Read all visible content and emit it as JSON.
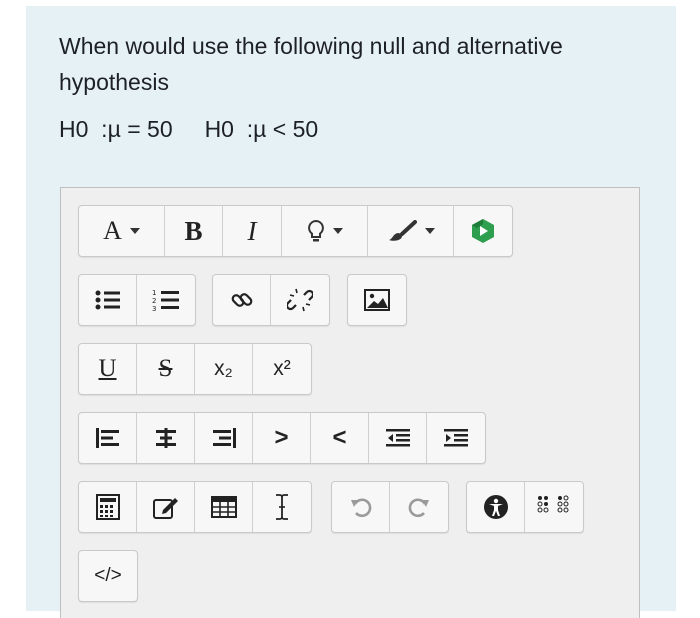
{
  "question": {
    "line1": "When would use the following null and alternative",
    "line2": "hypothesis",
    "hypotheses": "H0  :µ = 50     H0  :µ < 50"
  },
  "toolbar": {
    "font_color_label": "A",
    "bold_label": "B",
    "italic_label": "I",
    "underline_label": "U",
    "strike_label": "S",
    "subscript_label": "x₂",
    "superscript_label": "x²",
    "indent_label": ">",
    "outdent_label": "<",
    "html_label": "</>"
  },
  "colors": {
    "accent": "#2e9e4f",
    "card": "#e6f1f5"
  }
}
